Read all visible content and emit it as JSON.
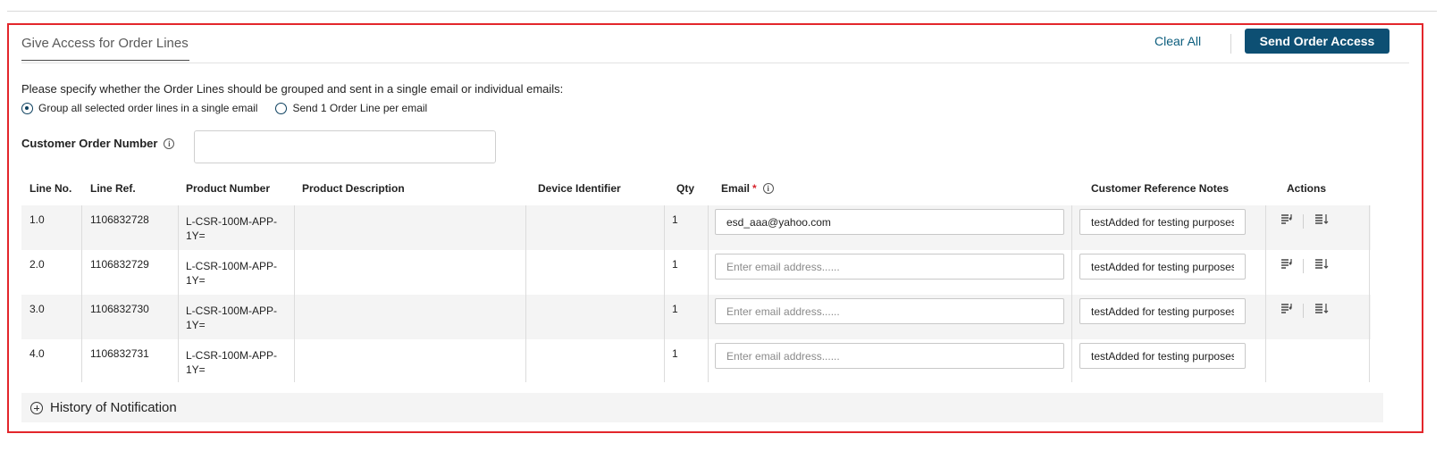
{
  "panel": {
    "title": "Give Access for Order Lines",
    "clear_all": "Clear All",
    "send_button": "Send Order Access"
  },
  "grouping": {
    "instruction": "Please specify whether the Order Lines should be grouped and sent in a single email or individual emails:",
    "options": [
      {
        "label": "Group all selected order lines in a single email",
        "selected": true
      },
      {
        "label": "Send 1 Order Line per email",
        "selected": false
      }
    ]
  },
  "customer_order": {
    "label": "Customer Order Number",
    "value": ""
  },
  "table": {
    "headers": {
      "line_no": "Line No.",
      "line_ref": "Line Ref.",
      "product_number": "Product Number",
      "product_description": "Product Description",
      "device_identifier": "Device Identifier",
      "qty": "Qty",
      "email": "Email",
      "email_required": "*",
      "notes": "Customer Reference Notes",
      "actions": "Actions"
    },
    "email_placeholder": "Enter email address......",
    "rows": [
      {
        "line_no": "1.0",
        "line_ref": "1106832728",
        "product_number": "L-CSR-100M-APP-1Y=",
        "product_description": "",
        "device_identifier": "",
        "qty": "1",
        "email": "esd_aaa@yahoo.com",
        "notes": "testAdded for testing purposes"
      },
      {
        "line_no": "2.0",
        "line_ref": "1106832729",
        "product_number": "L-CSR-100M-APP-1Y=",
        "product_description": "",
        "device_identifier": "",
        "qty": "1",
        "email": "",
        "notes": "testAdded for testing purposes"
      },
      {
        "line_no": "3.0",
        "line_ref": "1106832730",
        "product_number": "L-CSR-100M-APP-1Y=",
        "product_description": "",
        "device_identifier": "",
        "qty": "1",
        "email": "",
        "notes": "testAdded for testing purposes"
      },
      {
        "line_no": "4.0",
        "line_ref": "1106832731",
        "product_number": "L-CSR-100M-APP-1Y=",
        "product_description": "",
        "device_identifier": "",
        "qty": "1",
        "email": "",
        "notes": "testAdded for testing purposes"
      }
    ],
    "actions": {
      "copy_down_icon": "copy-to-next-icon",
      "apply_all_icon": "apply-to-all-icon"
    }
  },
  "history": {
    "label": "History of Notification"
  },
  "colors": {
    "panel_border": "#e3262b",
    "primary_button": "#0d4f73",
    "link": "#0b5d7d",
    "required": "#d7242c"
  }
}
